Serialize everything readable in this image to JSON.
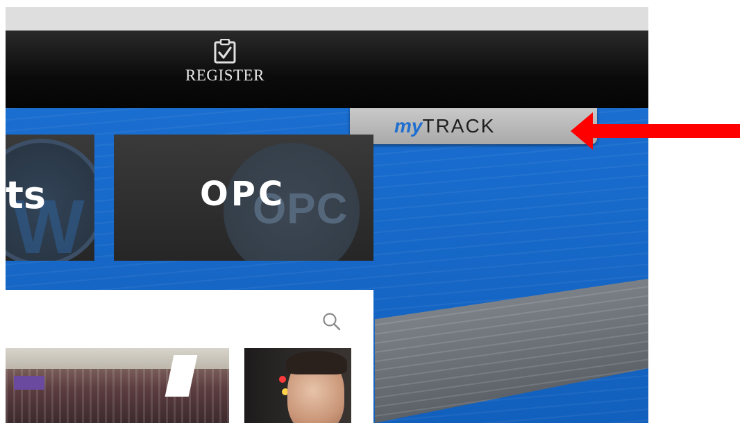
{
  "header": {
    "register_label": "REGISTER",
    "register_icon": "clipboard-check-icon"
  },
  "mytrack": {
    "my": "my",
    "track": "TRACK",
    "accent": "#1f6fd0"
  },
  "tiles": [
    {
      "text": "ts"
    },
    {
      "text": "OPC",
      "watermark": "OPC"
    }
  ],
  "feed": {
    "search_icon": "search-icon"
  },
  "annotation": {
    "arrow_color": "#ff0000"
  },
  "colors": {
    "navbar": "#0b0b0b",
    "background_blue": "#1565c6",
    "tile": "#2e2e2e"
  }
}
